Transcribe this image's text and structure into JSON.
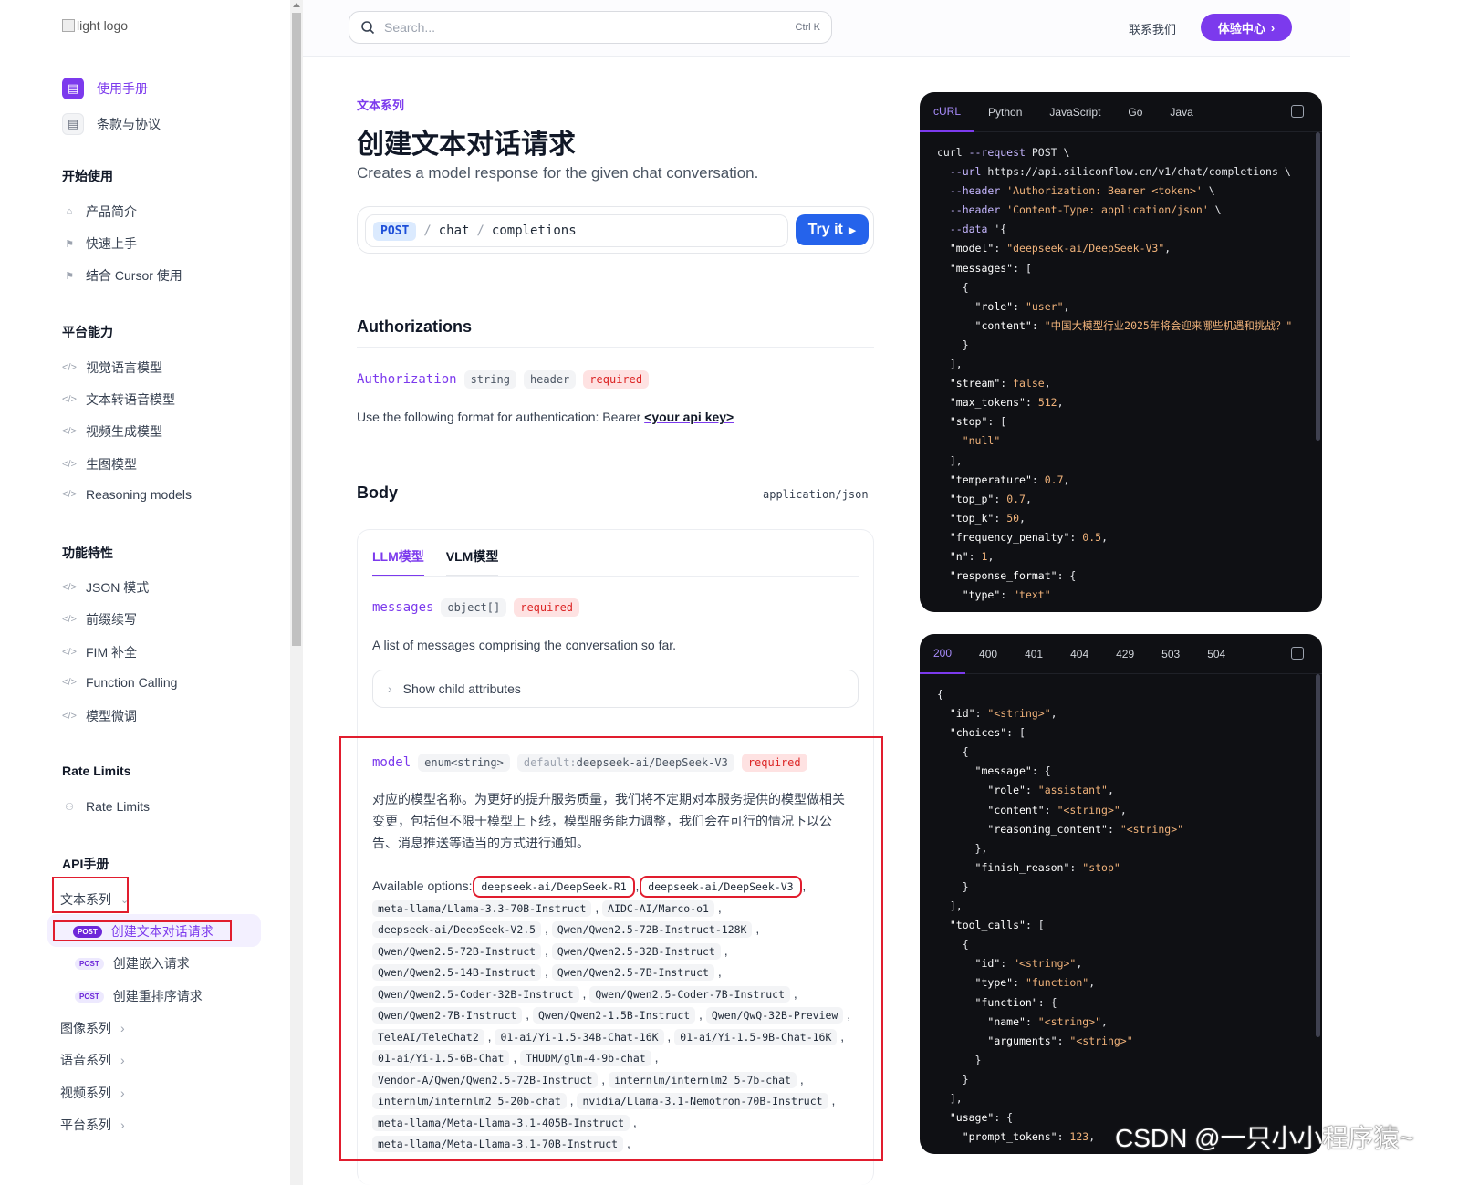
{
  "logo": {
    "alt": "light logo"
  },
  "top_links": [
    {
      "label": "使用手册",
      "active": true
    },
    {
      "label": "条款与协议",
      "active": false
    }
  ],
  "sidebar": {
    "sections": [
      {
        "title": "开始使用",
        "items": [
          "产品简介",
          "快速上手",
          "结合 Cursor 使用"
        ]
      },
      {
        "title": "平台能力",
        "items": [
          "视觉语言模型",
          "文本转语音模型",
          "视频生成模型",
          "生图模型",
          "Reasoning models"
        ]
      },
      {
        "title": "功能特性",
        "items": [
          "JSON 模式",
          "前缀续写",
          "FIM 补全",
          "Function Calling",
          "模型微调"
        ]
      },
      {
        "title": "Rate Limits",
        "items": [
          "Rate Limits"
        ]
      },
      {
        "title": "API手册",
        "items": []
      }
    ],
    "api_group": "文本系列",
    "api_items": [
      {
        "badge": "POST",
        "label": "创建文本对话请求",
        "active": true
      },
      {
        "badge": "POST",
        "label": "创建嵌入请求",
        "active": false
      },
      {
        "badge": "POST",
        "label": "创建重排序请求",
        "active": false
      }
    ],
    "api_series": [
      "图像系列",
      "语音系列",
      "视频系列",
      "平台系列"
    ]
  },
  "header": {
    "search_placeholder": "Search...",
    "search_shortcut": "Ctrl K",
    "contact": "联系我们",
    "cta": "体验中心"
  },
  "main": {
    "breadcrumb": "文本系列",
    "title": "创建文本对话请求",
    "subtitle": "Creates a model response for the given chat conversation.",
    "endpoint": {
      "method": "POST",
      "path1": "chat",
      "path2": "completions",
      "try": "Try it"
    },
    "auth": {
      "heading": "Authorizations",
      "name": "Authorization",
      "type": "string",
      "location": "header",
      "required": "required",
      "desc": "Use the following format for authentication: Bearer ",
      "desc_link": "<your api key>"
    },
    "body": {
      "heading": "Body",
      "content_type": "application/json",
      "tabs": [
        "LLM模型",
        "VLM模型"
      ],
      "messages": {
        "name": "messages",
        "type": "object[]",
        "required": "required",
        "desc": "A list of messages comprising the conversation so far.",
        "child": "Show child attributes"
      },
      "model": {
        "name": "model",
        "type": "enum<string>",
        "default_label": "default:",
        "default_value": "deepseek-ai/DeepSeek-V3",
        "required": "required",
        "desc": "对应的模型名称。为更好的提升服务质量，我们将不定期对本服务提供的模型做相关变更，包括但不限于模型上下线，模型服务能力调整，我们会在可行的情况下以公告、消息推送等适当的方式进行通知。",
        "options_label": "Available options:",
        "options": [
          "deepseek-ai/DeepSeek-R1",
          "deepseek-ai/DeepSeek-V3",
          "meta-llama/Llama-3.3-70B-Instruct",
          "AIDC-AI/Marco-o1",
          "deepseek-ai/DeepSeek-V2.5",
          "Qwen/Qwen2.5-72B-Instruct-128K",
          "Qwen/Qwen2.5-72B-Instruct",
          "Qwen/Qwen2.5-32B-Instruct",
          "Qwen/Qwen2.5-14B-Instruct",
          "Qwen/Qwen2.5-7B-Instruct",
          "Qwen/Qwen2.5-Coder-32B-Instruct",
          "Qwen/Qwen2.5-Coder-7B-Instruct",
          "Qwen/Qwen2-7B-Instruct",
          "Qwen/Qwen2-1.5B-Instruct",
          "Qwen/QwQ-32B-Preview",
          "TeleAI/TeleChat2",
          "01-ai/Yi-1.5-34B-Chat-16K",
          "01-ai/Yi-1.5-9B-Chat-16K",
          "01-ai/Yi-1.5-6B-Chat",
          "THUDM/glm-4-9b-chat",
          "Vendor-A/Qwen/Qwen2.5-72B-Instruct",
          "internlm/internlm2_5-7b-chat",
          "internlm/internlm2_5-20b-chat",
          "nvidia/Llama-3.1-Nemotron-70B-Instruct",
          "meta-llama/Meta-Llama-3.1-405B-Instruct",
          "meta-llama/Meta-Llama-3.1-70B-Instruct"
        ]
      }
    }
  },
  "code_panel": {
    "tabs": [
      "cURL",
      "Python",
      "JavaScript",
      "Go",
      "Java"
    ],
    "lines": [
      "curl --request POST \\",
      "  --url https://api.siliconflow.cn/v1/chat/completions \\",
      "  --header 'Authorization: Bearer <token>' \\",
      "  --header 'Content-Type: application/json' \\",
      "  --data '{",
      "  \"model\": \"deepseek-ai/DeepSeek-V3\",",
      "  \"messages\": [",
      "    {",
      "      \"role\": \"user\",",
      "      \"content\": \"中国大模型行业2025年将会迎来哪些机遇和挑战？\"",
      "    }",
      "  ],",
      "  \"stream\": false,",
      "  \"max_tokens\": 512,",
      "  \"stop\": [",
      "    \"null\"",
      "  ],",
      "  \"temperature\": 0.7,",
      "  \"top_p\": 0.7,",
      "  \"top_k\": 50,",
      "  \"frequency_penalty\": 0.5,",
      "  \"n\": 1,",
      "  \"response_format\": {",
      "    \"type\": \"text\""
    ]
  },
  "response_panel": {
    "tabs": [
      "200",
      "400",
      "401",
      "404",
      "429",
      "503",
      "504"
    ],
    "lines": [
      "{",
      "  \"id\": \"<string>\",",
      "  \"choices\": [",
      "    {",
      "      \"message\": {",
      "        \"role\": \"assistant\",",
      "        \"content\": \"<string>\",",
      "        \"reasoning_content\": \"<string>\"",
      "      },",
      "      \"finish_reason\": \"stop\"",
      "    }",
      "  ],",
      "  \"tool_calls\": [",
      "    {",
      "      \"id\": \"<string>\",",
      "      \"type\": \"function\",",
      "      \"function\": {",
      "        \"name\": \"<string>\",",
      "        \"arguments\": \"<string>\"",
      "      }",
      "    }",
      "  ],",
      "  \"usage\": {",
      "    \"prompt_tokens\": 123,"
    ]
  },
  "watermark": "CSDN @一只小小程序猿~",
  "colors": {
    "accent": "#7c3aed",
    "post_blue": "#2563eb",
    "highlight_box": "#e11d2e",
    "code_bg": "#0f1014"
  }
}
